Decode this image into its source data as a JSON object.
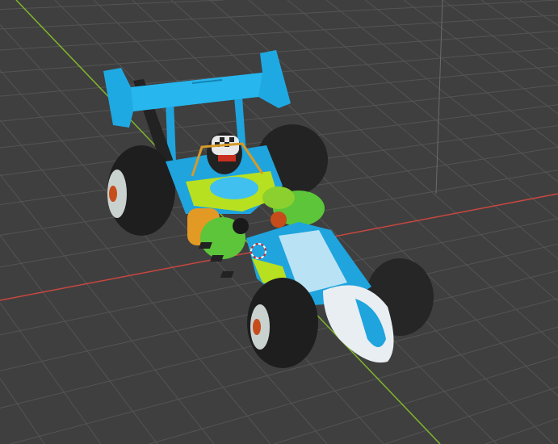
{
  "viewport": {
    "background_color": "#3f3f3f",
    "grid_color": "#545454",
    "x_axis_color": "#c8473f",
    "y_axis_color": "#7fb52a"
  },
  "model": {
    "body_color": "#1fa4dd",
    "accent_color": "#b7e021",
    "tire_color": "#1e1e1e",
    "exhaust_color": "#5cc53a",
    "nose_color": "#e8eef2"
  }
}
